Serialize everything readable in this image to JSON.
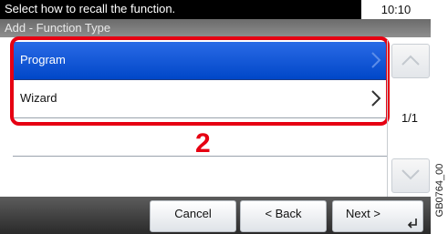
{
  "header": {
    "message": "Select how to recall the function.",
    "time": "10:10"
  },
  "subtitle": "Add - Function Type",
  "list": {
    "items": [
      {
        "label": "Program",
        "selected": true
      },
      {
        "label": "Wizard",
        "selected": false
      }
    ]
  },
  "pagination": "1/1",
  "annotation": {
    "step": "2",
    "color": "#e60012"
  },
  "footer": {
    "cancel_label": "Cancel",
    "back_label": "< Back",
    "next_label": "Next >"
  },
  "figure_code": "GB0764_00",
  "colors": {
    "selection": "#0047c8",
    "highlight": "#e60012"
  }
}
